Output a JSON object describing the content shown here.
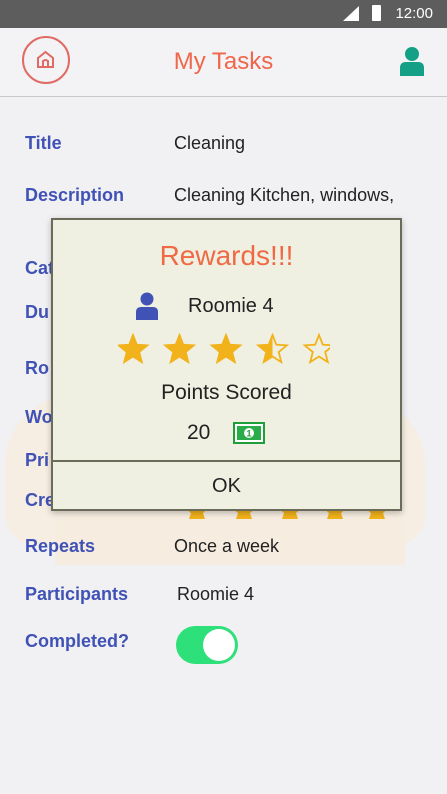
{
  "status_bar": {
    "time": "12:00"
  },
  "app_bar": {
    "title": "My Tasks"
  },
  "fields": {
    "title_label": "Title",
    "title_value": "Cleaning",
    "description_label": "Description",
    "description_value": "Cleaning Kitchen, windows,",
    "category_label": "Cat",
    "due_label": "Du",
    "roomie_label": "Ro",
    "worth_label": "Wo",
    "priority_label": "Pri",
    "created_label": "Cre",
    "repeats_label": "Repeats",
    "repeats_value": "Once a week",
    "participants_label": "Participants",
    "participants_value": "Roomie 4",
    "completed_label": "Completed?",
    "completed_value": true
  },
  "dialog": {
    "title": "Rewards!!!",
    "user": "Roomie 4",
    "rating": 3.5,
    "rating_max": 5,
    "points_label": "Points Scored",
    "points_value": "20",
    "ok_label": "OK"
  },
  "colors": {
    "accent": "#f0664a",
    "label": "#4052b5",
    "toggle_on": "#2ee07a",
    "star": "#f2b21b",
    "profile": "#13a086"
  }
}
